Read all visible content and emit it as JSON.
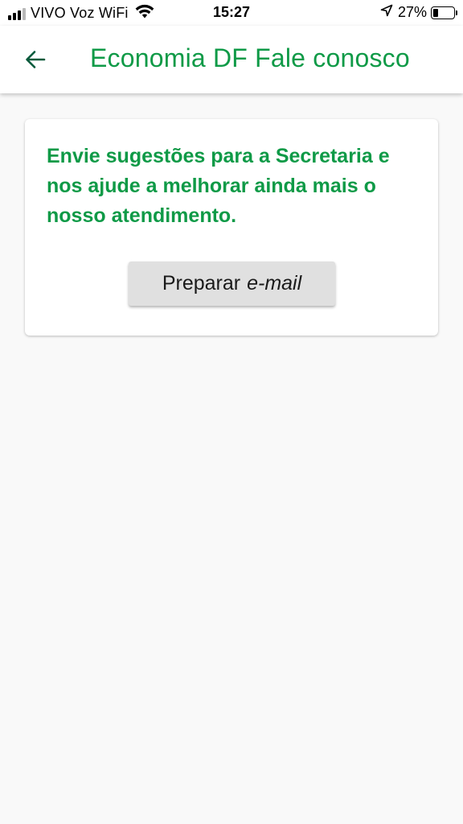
{
  "status_bar": {
    "carrier": "VIVO Voz WiFi",
    "time": "15:27",
    "battery_percent": "27%",
    "battery_level": 0.27
  },
  "app_bar": {
    "back_icon": "arrow-left-icon",
    "title": "Economia DF Fale conosco"
  },
  "card": {
    "message": "Envie sugestões para a Secretaria e nos ajude a melhorar ainda mais o nosso atendimento.",
    "button": {
      "label_regular": "Preparar",
      "label_italic": "e-mail"
    }
  },
  "colors": {
    "accent_green": "#0f9a47",
    "back_icon": "#0b5a3c",
    "background": "#f9f9f9",
    "button_bg": "#e0e0e0"
  }
}
